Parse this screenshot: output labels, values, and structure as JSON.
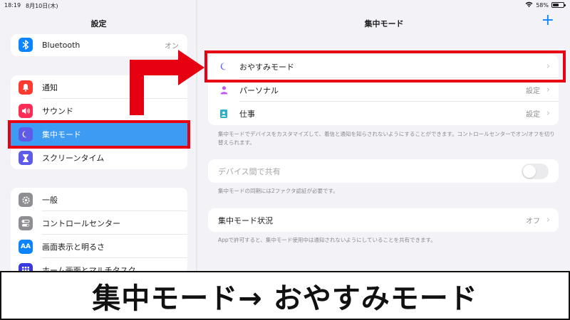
{
  "status_bar": {
    "time": "18:19",
    "date": "8月10日(木)",
    "battery_percent": "58%",
    "battery_level": 0.58
  },
  "sidebar": {
    "title": "設定",
    "groups": [
      [
        {
          "label": "Bluetooth",
          "value": "オン",
          "icon": "bluetooth-icon",
          "color": "#0a84ff"
        }
      ],
      [
        {
          "label": "通知",
          "icon": "bell-icon",
          "color": "#ff3b30"
        },
        {
          "label": "サウンド",
          "icon": "speaker-icon",
          "color": "#ff2d55"
        },
        {
          "label": "集中モード",
          "icon": "moon-icon",
          "color": "#5e5ce6",
          "selected": true
        },
        {
          "label": "スクリーンタイム",
          "icon": "hourglass-icon",
          "color": "#5e5ce6"
        }
      ],
      [
        {
          "label": "一般",
          "icon": "gear-icon",
          "color": "#8e8e93"
        },
        {
          "label": "コントロールセンター",
          "icon": "toggles-icon",
          "color": "#8e8e93"
        },
        {
          "label": "画面表示と明るさ",
          "icon": "text-size-icon",
          "color": "#0a84ff",
          "glyph": "AA"
        },
        {
          "label": "ホーム画面とマルチタスク",
          "icon": "grid-icon",
          "color": "#3a3ae0"
        }
      ]
    ]
  },
  "main": {
    "title": "集中モード",
    "add_label": "+",
    "focus_modes": [
      {
        "label": "おやすみモード",
        "value": "",
        "icon": "moon-icon",
        "icon_color": "#5e5ce6"
      },
      {
        "label": "パーソナル",
        "value": "設定",
        "icon": "person-icon",
        "icon_color": "#bf5af2"
      },
      {
        "label": "仕事",
        "value": "設定",
        "icon": "id-badge-icon",
        "icon_color": "#30b0c7"
      }
    ],
    "focus_note": "集中モードでデバイスをカスタマイズして、着信と通知を知らされないようにすることができます。コントロールセンターでオン/オフを切り替えられます。",
    "share_across_devices": {
      "label": "デバイス間で共有",
      "enabled": false
    },
    "share_note": "集中モードの同期には2ファクタ認証が必要です。",
    "focus_status": {
      "label": "集中モード状況",
      "value": "オフ"
    },
    "status_note": "Appで許可すると、集中モード使用中は通知されないようにしていることを共有できます。"
  },
  "annotation": {
    "caption": "集中モード→ おやすみモード",
    "highlight_color": "#e60012"
  }
}
